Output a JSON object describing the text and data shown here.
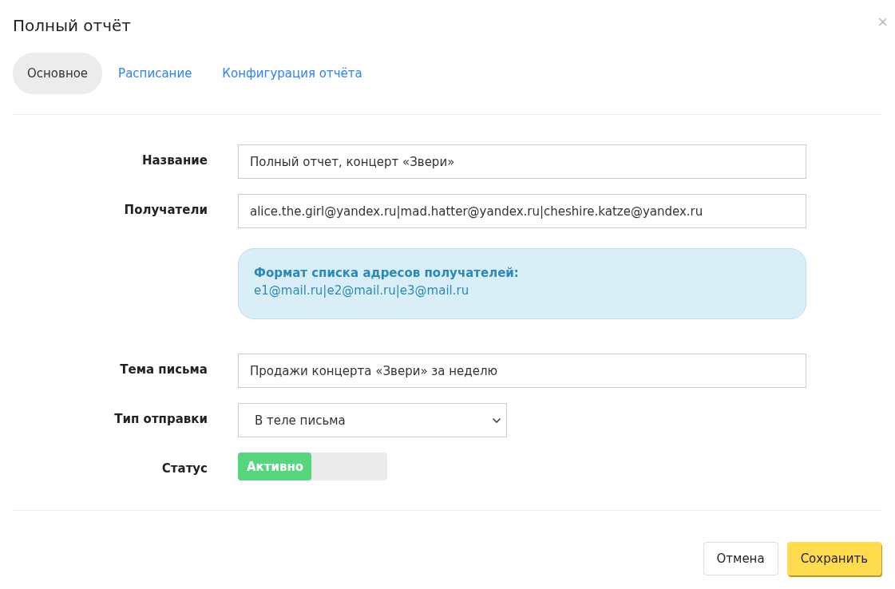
{
  "dialog": {
    "title": "Полный отчёт",
    "close": "×"
  },
  "tabs": [
    {
      "label": "Основное",
      "selected": true
    },
    {
      "label": "Расписание",
      "selected": false
    },
    {
      "label": "Конфигурация отчёта",
      "selected": false
    }
  ],
  "form": {
    "rows": [
      {
        "kind": "text",
        "label": "Название",
        "value": "Полный отчет, концерт «Звери»"
      },
      {
        "kind": "text",
        "label": "Получатели",
        "value": "alice.the.girl@yandex.ru|mad.hatter@yandex.ru|cheshire.katze@yandex.ru"
      },
      {
        "kind": "hint",
        "title": "Формат списка адресов получателей:",
        "text": "e1@mail.ru|e2@mail.ru|e3@mail.ru"
      },
      {
        "kind": "text",
        "label": "Тема письма",
        "value": "Продажи концерта «Звери» за неделю"
      },
      {
        "kind": "select",
        "label": "Тип отправки",
        "value": "В теле письма"
      },
      {
        "kind": "toggle",
        "label": "Статус",
        "value": "Активно",
        "on": true
      }
    ]
  },
  "buttons": [
    {
      "kind": "secondary",
      "label": "Отмена"
    },
    {
      "kind": "primary",
      "label": "Сохранить"
    }
  ]
}
